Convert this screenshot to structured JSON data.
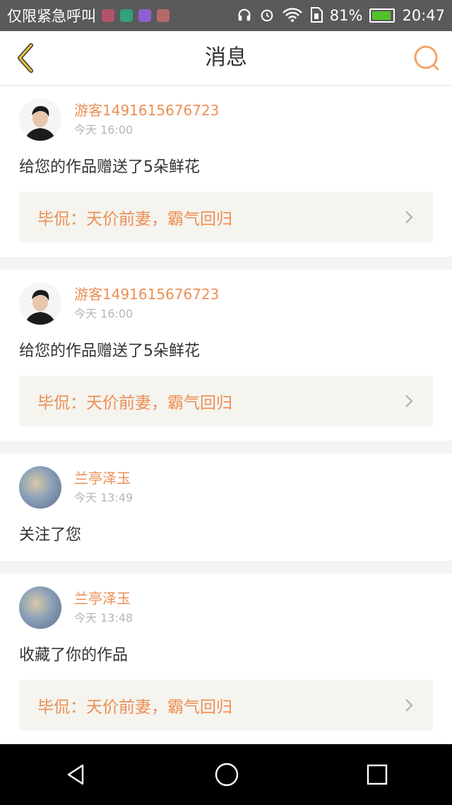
{
  "status_bar": {
    "carrier": "仅限紧急呼叫",
    "battery": "81%",
    "time": "20:47",
    "app_icon_colors": [
      "#b3536b",
      "#35a07d",
      "#8d5fd3",
      "#b56a6a"
    ]
  },
  "header": {
    "title": "消息",
    "back_icon": "chevron-left-icon",
    "search_icon": "search-icon",
    "accent": "#e7c23b"
  },
  "messages": [
    {
      "username": "游客1491615676723",
      "time": "今天 16:00",
      "action": "给您的作品赠送了5朵鲜花",
      "work": "毕侃：天价前妻，霸气回归"
    },
    {
      "username": "游客1491615676723",
      "time": "今天 16:00",
      "action": "给您的作品赠送了5朵鲜花",
      "work": "毕侃：天价前妻，霸气回归"
    },
    {
      "username": "兰亭泽玉",
      "time": "今天 13:49",
      "action": "关注了您"
    },
    {
      "username": "兰亭泽玉",
      "time": "今天 13:48",
      "action": "收藏了你的作品",
      "work": "毕侃：天价前妻，霸气回归"
    }
  ],
  "colors": {
    "username": "#ec8f55",
    "link_bg": "#f5f4ef",
    "page_bg": "#f4f4f4"
  },
  "nav": {
    "back": "triangle-back-icon",
    "home": "circle-home-icon",
    "recents": "square-recents-icon"
  }
}
